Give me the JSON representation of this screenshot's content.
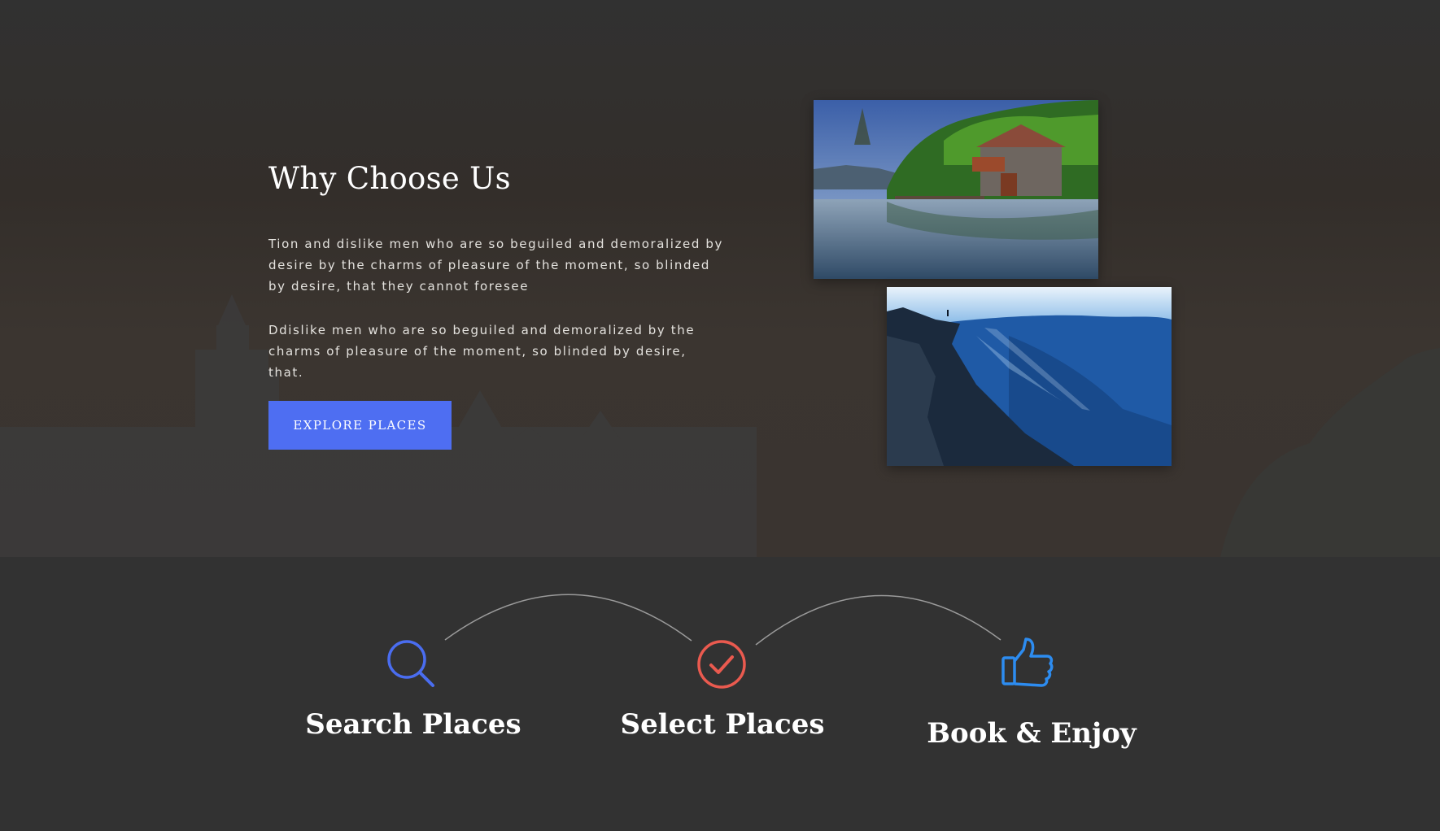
{
  "why": {
    "title": "Why Choose Us",
    "paragraph_1": "Tion and dislike men who are so beguiled and demoralized by desire by the charms of pleasure of the moment, so blinded by desire, that they cannot foresee",
    "paragraph_2": "Ddislike men who are so beguiled and demoralized by the charms of pleasure of the moment, so blinded by desire, that.",
    "button_label": "EXPLORE PLACES"
  },
  "photos": [
    {
      "subject": "boathouse on a lake"
    },
    {
      "subject": "blue mountain canyon"
    }
  ],
  "steps": [
    {
      "label": "Search Places",
      "icon": "search-icon",
      "color": "#4a6df0"
    },
    {
      "label": "Select Places",
      "icon": "check-circle-icon",
      "color": "#ea5a4f"
    },
    {
      "label": "Book & Enjoy",
      "icon": "thumbs-up-icon",
      "color": "#2d8cf0"
    }
  ],
  "colors": {
    "accent": "#4e6ef2",
    "background": "#323232"
  }
}
